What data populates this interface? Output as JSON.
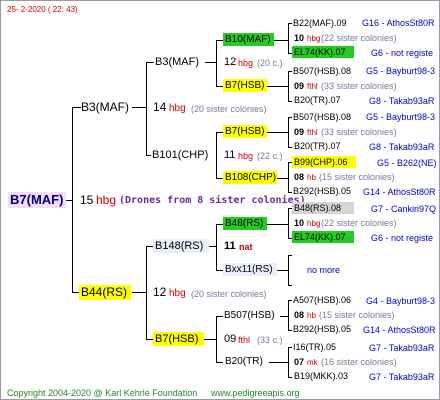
{
  "header": {
    "date": "25-  2-2020  ( 22:  43)"
  },
  "colors": {
    "yellow": "#ffff00",
    "green": "#22cc22",
    "pink": "#f5dcf5",
    "blue_tint": "#e8eefa",
    "grey_tint": "#d4d4d4",
    "sister_red": "#cc0000"
  },
  "root": {
    "name": "B7(MAF)",
    "num": "15",
    "unit": "hbg",
    "note": "(Drones from 8 sister colonies)"
  },
  "level1": [
    {
      "name": "B3(MAF)",
      "num": "14",
      "unit": "hbg",
      "note": "(20 sister colonies)"
    },
    {
      "name": "B44(RS)",
      "num": "12",
      "unit": "hbg",
      "note": "(20 sister colonies)"
    }
  ],
  "level2": [
    {
      "name": "B3(MAF)",
      "num": "12",
      "unit": "hbg",
      "note": "(20 c.)"
    },
    {
      "name": "B101(CHP)",
      "num": "11",
      "unit": "hbg",
      "note": "(22 c.)"
    },
    {
      "name": "B148(RS)",
      "num": "11",
      "unit": "nat",
      "note": ""
    },
    {
      "name": "B7(HSB)",
      "num": "09",
      "unit": "fthl",
      "note": "(33 c.)"
    }
  ],
  "level3": [
    {
      "name": "B10(MAF)"
    },
    {
      "name": "B7(HSB)"
    },
    {
      "name": "B7(HSB)"
    },
    {
      "name": "B108(CHP)"
    },
    {
      "name": "B48(RS)"
    },
    {
      "name": "Bxx11(RS)"
    },
    {
      "name": "B507(HSB)"
    },
    {
      "name": "B20(TR)"
    }
  ],
  "level4": [
    {
      "queen": "B22(MAF).09",
      "src": "G16 - AthosSt80R",
      "num": "10",
      "unit": "hbg",
      "note": "(22 sister colonies)",
      "drone": "EL74(KK).07",
      "dsrc": "G6 - not registe"
    },
    {
      "queen": "B507(HSB).08",
      "src": "G5 - Bayburt98-3",
      "num": "09",
      "unit": "fthl",
      "note": "(33 sister colonies)",
      "drone": "B20(TR).07",
      "dsrc": "G8 - Takab93aR"
    },
    {
      "queen": "B507(HSB).08",
      "src": "G5 - Bayburt98-3",
      "num": "09",
      "unit": "fthl",
      "note": "(33 sister colonies)",
      "drone": "B20(TR).07",
      "dsrc": "G8 - Takab93aR"
    },
    {
      "queen": "B99(CHP).06",
      "src": "G5 - B262(NE)",
      "num": "08",
      "unit": "hb",
      "note": "(15 sister colonies)",
      "drone": "B292(HSB).05",
      "dsrc": "G14 - AthosSt80R"
    },
    {
      "queen": "B48(RS).08",
      "src": "G7 - Cankiri97Q",
      "num": "10",
      "unit": "hbg",
      "note": "(22 sister colonies)",
      "drone": "EL74(KK).07",
      "dsrc": "G6 - not registe"
    },
    {
      "queen": "",
      "src": "",
      "num": "",
      "unit": "",
      "note": "no more",
      "drone": "",
      "dsrc": ""
    },
    {
      "queen": "A507(HSB).06",
      "src": "G4 - Bayburt98-3",
      "num": "08",
      "unit": "hb",
      "note": "(15 sister colonies)",
      "drone": "B292(HSB).05",
      "dsrc": "G14 - AthosSt80R"
    },
    {
      "queen": "I16(TR).05",
      "src": "G7 - Takab93aR",
      "num": "07",
      "unit": "mk",
      "note": "(16 sister colonies)",
      "drone": "B19(MKK).03",
      "dsrc": "G7 - Takab93aR"
    }
  ],
  "footer": {
    "copyright": "Copyright 2004-2020 @ Karl Kehrle Foundation",
    "url": "www.pedigreeapis.org"
  }
}
